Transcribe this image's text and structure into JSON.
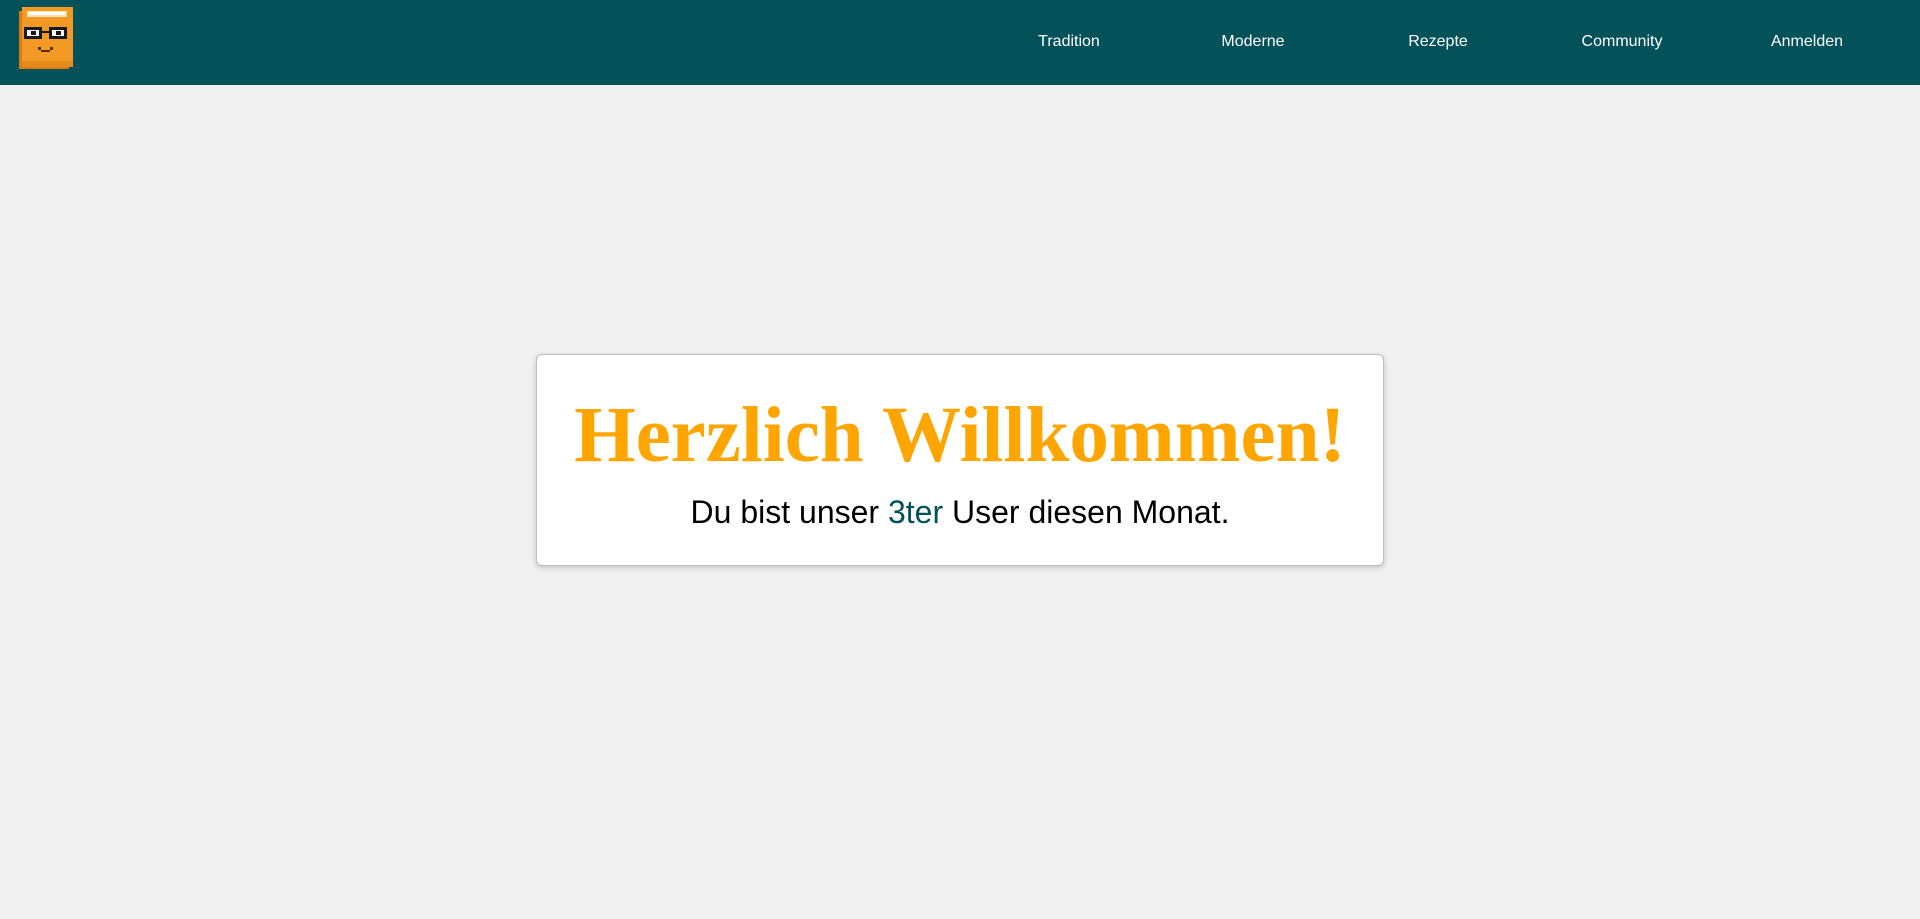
{
  "header": {
    "background_color": "#03525a",
    "logo_icon": "nerd-mascot-icon",
    "nav": [
      {
        "label": "Tradition"
      },
      {
        "label": "Moderne"
      },
      {
        "label": "Rezepte"
      },
      {
        "label": "Community"
      },
      {
        "label": "Anmelden"
      }
    ]
  },
  "welcome": {
    "title": "Herzlich Willkommen!",
    "title_color": "#ffa500",
    "message_prefix": "Du bist unser",
    "user_rank": "3ter",
    "message_suffix": "User diesen Monat.",
    "highlight_color": "#03525a"
  }
}
